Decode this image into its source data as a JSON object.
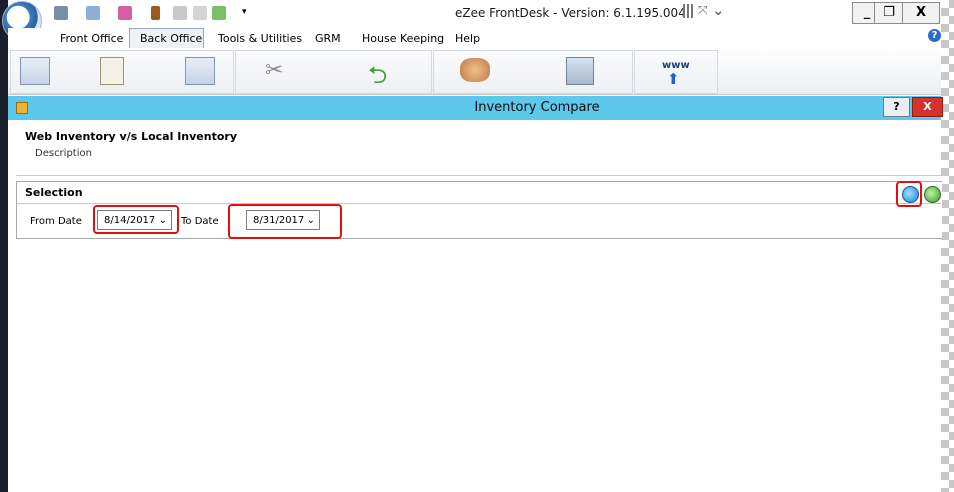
{
  "app": {
    "title": "eZee FrontDesk - Version: 6.1.195.004",
    "window_buttons": {
      "minimize": "_",
      "maximize": "❐",
      "close": "X"
    }
  },
  "menu": {
    "items": [
      "Front Office",
      "Back Office",
      "Tools & Utilities",
      "GRM",
      "House Keeping",
      "Help"
    ],
    "selected": "Back Office"
  },
  "ribbon": {
    "www_label": "www"
  },
  "dialog": {
    "title": "Inventory Compare",
    "help_label": "?",
    "close_label": "X",
    "heading": "Web Inventory v/s Local Inventory",
    "description": "Description"
  },
  "selection": {
    "title": "Selection",
    "from_label": "From Date",
    "from_value": "8/14/2017",
    "to_label": "To Date",
    "to_value": "8/31/2017"
  },
  "colors": {
    "dialog_bar": "#5ec8ec",
    "highlight": "#e01010"
  }
}
